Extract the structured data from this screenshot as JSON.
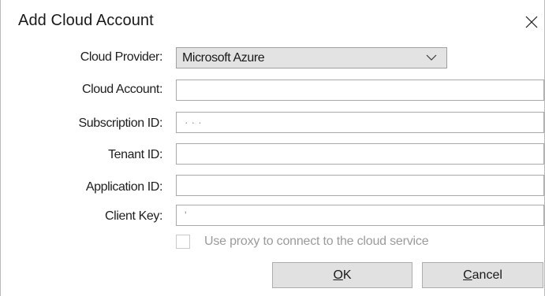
{
  "dialog": {
    "title": "Add Cloud Account",
    "close_icon": "close-icon"
  },
  "form": {
    "cloud_provider": {
      "label": "Cloud Provider:",
      "selected": "Microsoft Azure",
      "icon": "chevron-down-icon"
    },
    "cloud_account": {
      "label": "Cloud Account:",
      "value": ""
    },
    "subscription_id": {
      "label": "Subscription ID:",
      "value": "· · ·"
    },
    "tenant_id": {
      "label": "Tenant ID:",
      "value": ""
    },
    "application_id": {
      "label": "Application ID:",
      "value": ""
    },
    "client_key": {
      "label": "Client Key:",
      "value": "'"
    }
  },
  "options": {
    "use_proxy_label": "Use proxy to connect to the cloud service",
    "use_proxy_checked": false,
    "use_proxy_enabled": false
  },
  "buttons": {
    "ok_mnemonic": "O",
    "ok_rest": "K",
    "cancel_mnemonic": "C",
    "cancel_rest": "ancel"
  },
  "colors": {
    "button_bg": "#e1e1e1",
    "disabled_text": "#9b9b9b",
    "field_border": "#a9a9a9"
  }
}
